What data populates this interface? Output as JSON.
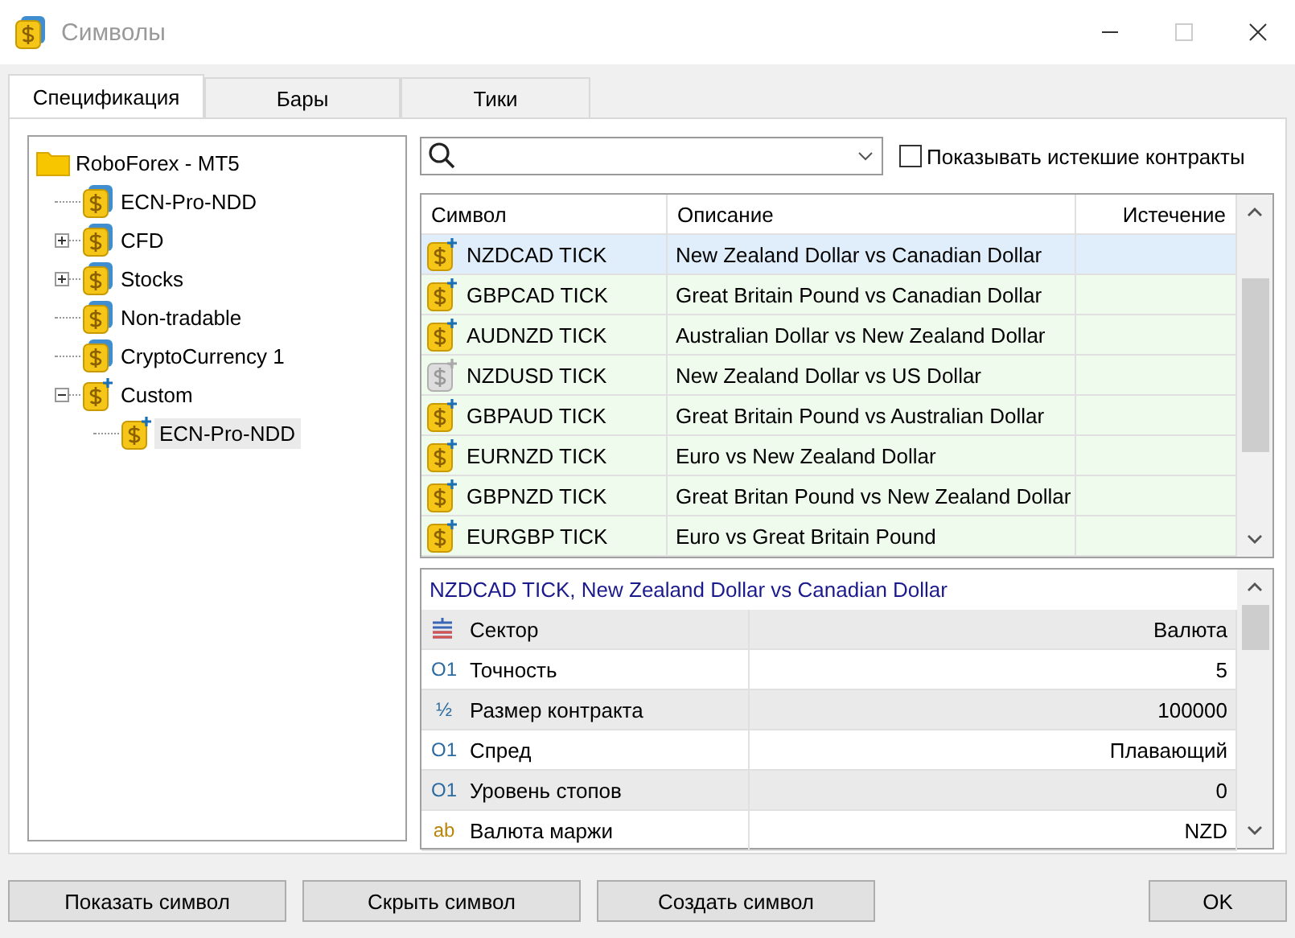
{
  "window": {
    "title": "Символы"
  },
  "tabs": [
    {
      "label": "Спецификация",
      "selected": true
    },
    {
      "label": "Бары",
      "selected": false
    },
    {
      "label": "Тики",
      "selected": false
    }
  ],
  "tree": [
    {
      "label": "RoboForex - MT5",
      "kind": "folder",
      "selected": false,
      "children": [
        {
          "label": "ECN-Pro-NDD",
          "kind": "group",
          "selected": false
        },
        {
          "label": "CFD",
          "kind": "group",
          "selected": false,
          "expanded": false
        },
        {
          "label": "Stocks",
          "kind": "group",
          "selected": false,
          "expanded": false
        },
        {
          "label": "Non-tradable",
          "kind": "group",
          "selected": false
        },
        {
          "label": "CryptoCurrency 1",
          "kind": "group",
          "selected": false
        },
        {
          "label": "Custom",
          "kind": "custom",
          "selected": false,
          "expanded": true,
          "children": [
            {
              "label": "ECN-Pro-NDD",
              "kind": "custom",
              "selected": true
            }
          ]
        }
      ]
    }
  ],
  "show_expired": {
    "label": "Показывать истекшие контракты",
    "checked": false
  },
  "table": {
    "columns": [
      "Символ",
      "Описание",
      "Истечение"
    ],
    "rows": [
      {
        "symbol": "NZDCAD TICK",
        "description": "New Zealand Dollar vs Canadian Dollar",
        "enabled": true,
        "selected": true
      },
      {
        "symbol": "GBPCAD TICK",
        "description": "Great Britain Pound vs Canadian Dollar",
        "enabled": true,
        "selected": false
      },
      {
        "symbol": "AUDNZD TICK",
        "description": "Australian Dollar vs New Zealand Dollar",
        "enabled": true,
        "selected": false
      },
      {
        "symbol": "NZDUSD TICK",
        "description": "New Zealand Dollar vs US Dollar",
        "enabled": false,
        "selected": false
      },
      {
        "symbol": "GBPAUD TICK",
        "description": "Great Britain Pound vs Australian Dollar",
        "enabled": true,
        "selected": false
      },
      {
        "symbol": "EURNZD TICK",
        "description": "Euro vs New Zealand Dollar",
        "enabled": true,
        "selected": false
      },
      {
        "symbol": "GBPNZD TICK",
        "description": "Great Britan Pound vs New Zealand Dollar",
        "enabled": true,
        "selected": false
      },
      {
        "symbol": "EURGBP TICK",
        "description": "Euro vs Great Britain Pound",
        "enabled": true,
        "selected": false
      }
    ]
  },
  "properties": {
    "header_symbol": "NZDCAD TICK",
    "header_description": ", New Zealand Dollar vs Canadian Dollar",
    "rows": [
      {
        "kind": "sector",
        "name": "Сектор",
        "value": "Валюта"
      },
      {
        "kind": "number",
        "glyph": "O1",
        "name": "Точность",
        "value": "5"
      },
      {
        "kind": "fraction",
        "glyph": "½",
        "name": "Размер контракта",
        "value": "100000"
      },
      {
        "kind": "number",
        "glyph": "O1",
        "name": "Спред",
        "value": "Плавающий"
      },
      {
        "kind": "number",
        "glyph": "O1",
        "name": "Уровень стопов",
        "value": "0"
      },
      {
        "kind": "string",
        "glyph": "ab",
        "name": "Валюта маржи",
        "value": "NZD"
      }
    ]
  },
  "buttons": [
    "Показать символ",
    "Скрыть символ",
    "Создать символ",
    "OK"
  ]
}
